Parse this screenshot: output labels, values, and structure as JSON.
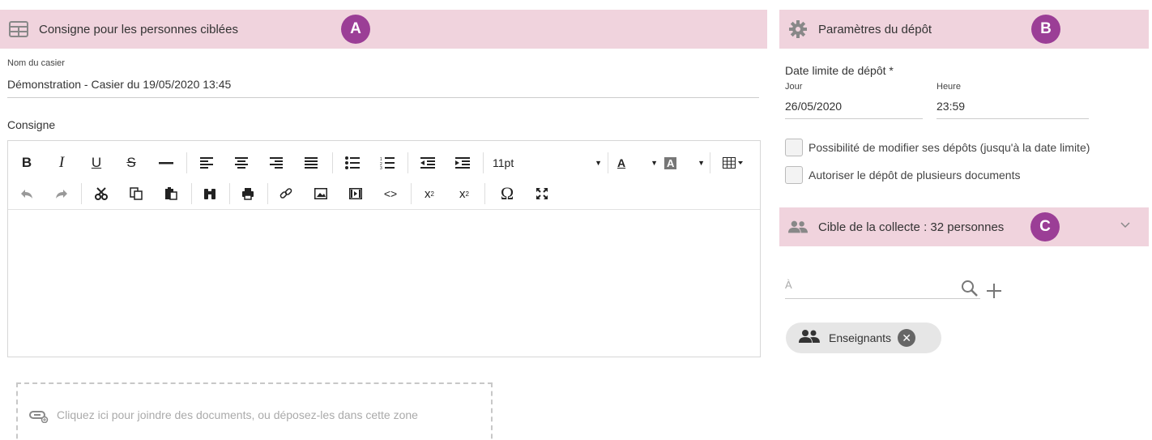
{
  "left_panel": {
    "header_title": "Consigne pour les personnes ciblées",
    "badge": "A",
    "name_label": "Nom du casier",
    "name_value": "Démonstration - Casier du 19/05/2020 13:45",
    "instruction_label": "Consigne",
    "font_size_value": "11pt",
    "text_color_label": "A",
    "highlight_label": "A",
    "dropzone_text": "Cliquez ici pour joindre des documents, ou déposez-les dans cette zone"
  },
  "settings_panel": {
    "header_title": "Paramètres du dépôt",
    "badge": "B",
    "deadline_label": "Date limite de dépôt *",
    "day_label": "Jour",
    "hour_label": "Heure",
    "day_value": "26/05/2020",
    "hour_value": "23:59",
    "option_modify": "Possibilité de modifier ses dépôts (jusqu'à la date limite)",
    "option_multiple": "Autoriser le dépôt de plusieurs documents"
  },
  "target_panel": {
    "header_title": "Cible de la collecte : 32 personnes",
    "badge": "C",
    "to_placeholder": "À",
    "chips": [
      {
        "label": "Enseignants"
      }
    ]
  },
  "colors": {
    "header_bg": "#f0d3dd",
    "badge_bg": "#9b3e96"
  }
}
